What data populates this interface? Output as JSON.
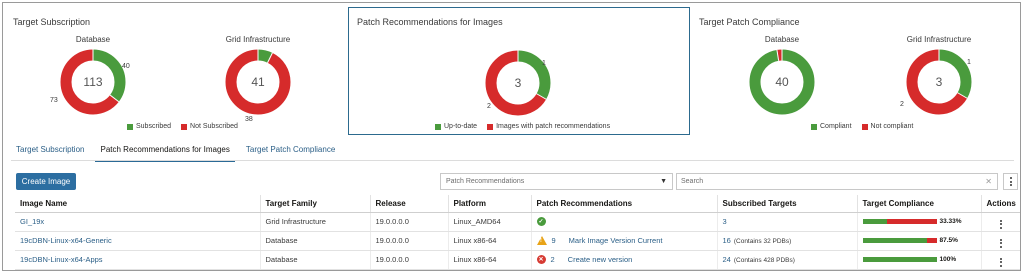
{
  "cards": {
    "target_subscription": {
      "title": "Target Subscription",
      "database": {
        "label": "Database",
        "total": "113",
        "subscribed": "40",
        "not_subscribed": "73",
        "subscribed_value": 40,
        "not_subscribed_value": 73
      },
      "grid": {
        "label": "Grid Infrastructure",
        "total": "41",
        "subscribed": "",
        "not_subscribed": "38",
        "subscribed_value": 3,
        "not_subscribed_value": 38
      },
      "legend": [
        "Subscribed",
        "Not Subscribed"
      ]
    },
    "patch_recommendations": {
      "title": "Patch Recommendations for Images",
      "total": "3",
      "up_to_date": "1",
      "with_recommendations": "2",
      "up_to_date_value": 1,
      "with_recommendations_value": 2,
      "legend": [
        "Up-to-date",
        "Images with patch recommendations"
      ]
    },
    "target_patch_compliance": {
      "title": "Target Patch Compliance",
      "database": {
        "label": "Database",
        "total": "40",
        "compliant_value": 39,
        "not_compliant_value": 1
      },
      "grid": {
        "label": "Grid Infrastructure",
        "total": "3",
        "compliant": "1",
        "not_compliant": "2",
        "compliant_value": 1,
        "not_compliant_value": 2
      },
      "legend": [
        "Compliant",
        "Not compliant"
      ]
    },
    "colors": {
      "green": "#4a9b3d",
      "red": "#d62b2b"
    }
  },
  "tabs": [
    {
      "label": "Target Subscription"
    },
    {
      "label": "Patch Recommendations for Images",
      "active": true
    },
    {
      "label": "Target Patch Compliance"
    }
  ],
  "toolbar": {
    "create_label": "Create Image",
    "filter_selected": "Patch Recommendations",
    "search_placeholder": "Search"
  },
  "table": {
    "headers": [
      "Image Name",
      "Target Family",
      "Release",
      "Platform",
      "Patch Recommendations",
      "Subscribed Targets",
      "Target Compliance",
      "Actions"
    ],
    "rows": [
      {
        "name": "GI_19x",
        "family": "Grid Infrastructure",
        "release": "19.0.0.0.0",
        "platform": "Linux_AMD64",
        "rec_icon": "check-icon",
        "rec_count": "",
        "rec_text": "",
        "targets": "3",
        "targets_note": "",
        "compliance_pct": "33.33%",
        "compliance_value": 33.33
      },
      {
        "name": "19cDBN-Linux-x64-Generic",
        "family": "Database",
        "release": "19.0.0.0.0",
        "platform": "Linux x86-64",
        "rec_icon": "warning-icon",
        "rec_count": "9",
        "rec_text": "Mark Image Version Current",
        "targets": "16",
        "targets_note": "(Contains 32 PDBs)",
        "compliance_pct": "87.5%",
        "compliance_value": 87.5
      },
      {
        "name": "19cDBN-Linux-x64-Apps",
        "family": "Database",
        "release": "19.0.0.0.0",
        "platform": "Linux x86-64",
        "rec_icon": "error-icon",
        "rec_count": "2",
        "rec_text": "Create new version",
        "targets": "24",
        "targets_note": "(Contains 428 PDBs)",
        "compliance_pct": "100%",
        "compliance_value": 100
      }
    ]
  }
}
